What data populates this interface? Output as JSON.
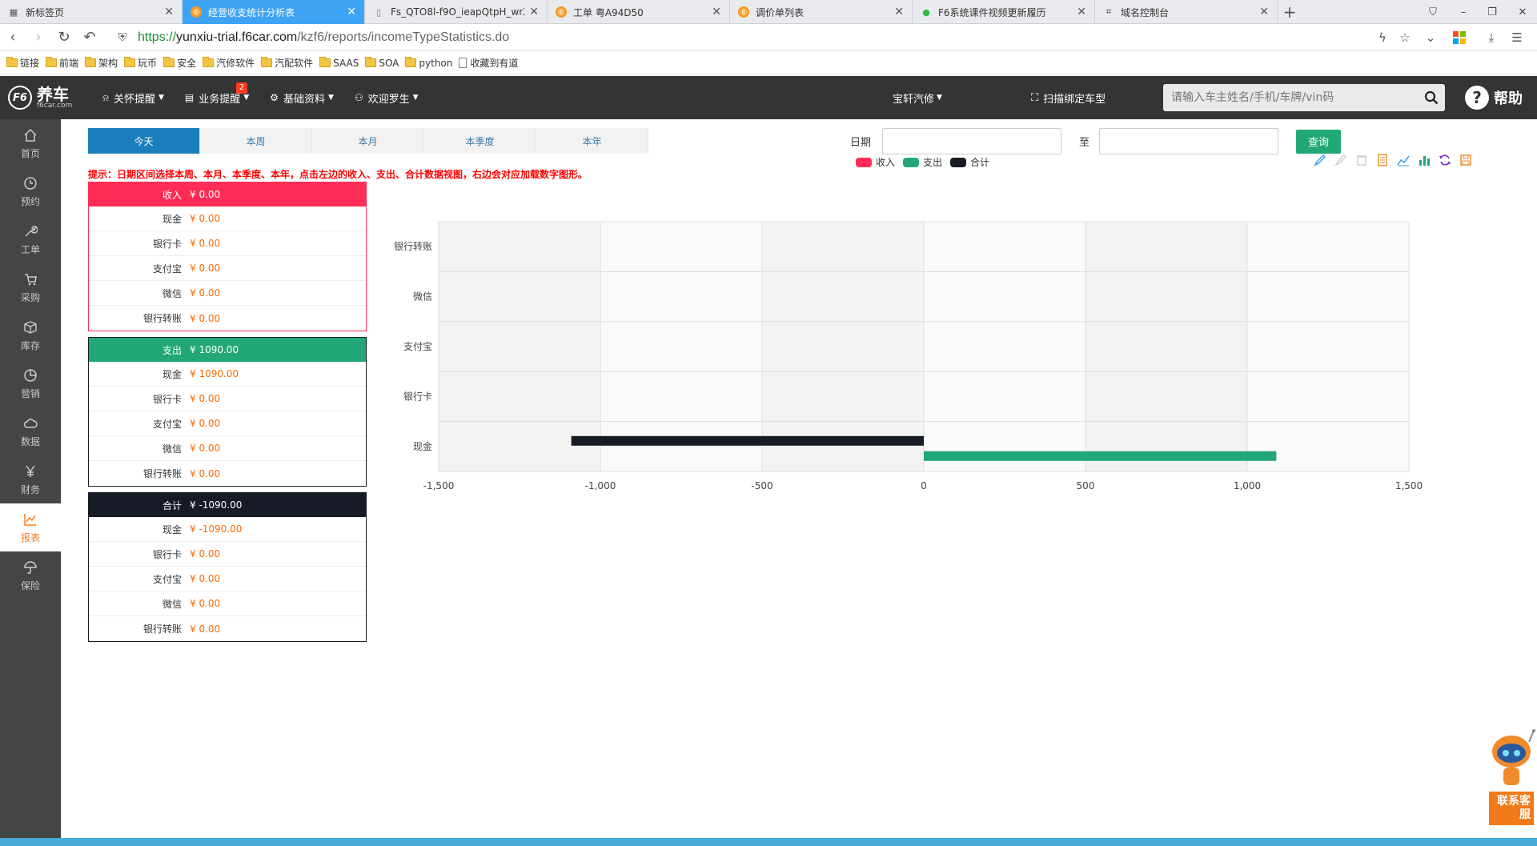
{
  "browser": {
    "tabs": [
      {
        "label": "新标签页",
        "icon": "grid-icon",
        "active": false
      },
      {
        "label": "经营收支统计分析表",
        "icon": "f6-logo-icon",
        "active": true
      },
      {
        "label": "Fs_QTO8l-f9O_ieapQtpH_wrZ",
        "icon": "page-icon",
        "active": false
      },
      {
        "label": "工单 粤A94D50",
        "icon": "f6-logo-icon",
        "active": false
      },
      {
        "label": "调价单列表",
        "icon": "f6-logo-icon",
        "active": false
      },
      {
        "label": "F6系统课件视频更新履历",
        "icon": "wechat-icon",
        "active": false
      },
      {
        "label": "域名控制台",
        "icon": "bracket-icon",
        "active": false
      }
    ],
    "url_proto": "https://",
    "url_host": "yunxiu-trial.f6car.com",
    "url_path": "/kzf6/reports/incomeTypeStatistics.do",
    "bookmarks": [
      "链接",
      "前端",
      "架构",
      "玩币",
      "安全",
      "汽修软件",
      "汽配软件",
      "SAAS",
      "SOA",
      "python",
      "收藏到有道"
    ]
  },
  "header": {
    "logo_text": "养车",
    "logo_sub": "f6car.com",
    "logo_badge": "F6",
    "menus": [
      {
        "label": "关怀提醒",
        "icon": "bell-icon"
      },
      {
        "label": "业务提醒",
        "icon": "clipboard-icon",
        "badge": "2"
      },
      {
        "label": "基础资料",
        "icon": "gear-icon"
      },
      {
        "label": "欢迎罗生",
        "icon": "user-icon"
      }
    ],
    "store": "宝轩汽修",
    "scan": "扫描绑定车型",
    "search_placeholder": "请输入车主姓名/手机/车牌/vin码",
    "help": "帮助"
  },
  "sidebar": [
    {
      "label": "首页",
      "icon": "home-icon"
    },
    {
      "label": "预约",
      "icon": "clock-icon"
    },
    {
      "label": "工单",
      "icon": "wrench-icon"
    },
    {
      "label": "采购",
      "icon": "cart-icon"
    },
    {
      "label": "库存",
      "icon": "box-icon"
    },
    {
      "label": "营销",
      "icon": "pie-icon"
    },
    {
      "label": "数据",
      "icon": "cloud-icon"
    },
    {
      "label": "财务",
      "icon": "yen-icon"
    },
    {
      "label": "报表",
      "icon": "chart-line-icon",
      "active": true
    },
    {
      "label": "保险",
      "icon": "umbrella-icon"
    }
  ],
  "periods": [
    "今天",
    "本周",
    "本月",
    "本季度",
    "本年"
  ],
  "date_filter": {
    "label": "日期",
    "to": "至",
    "query": "查询"
  },
  "hint": "提示：日期区间选择本周、本月、本季度、本年，点击左边的收入、支出、合计数据视图，右边会对应加载数字图形。",
  "panels": [
    {
      "title": "收入",
      "total": "¥ 0.00",
      "color": "#ff2d55",
      "rows": [
        {
          "label": "现金",
          "value": "¥ 0.00"
        },
        {
          "label": "银行卡",
          "value": "¥ 0.00"
        },
        {
          "label": "支付宝",
          "value": "¥ 0.00"
        },
        {
          "label": "微信",
          "value": "¥ 0.00"
        },
        {
          "label": "银行转账",
          "value": "¥ 0.00"
        }
      ]
    },
    {
      "title": "支出",
      "total": "¥ 1090.00",
      "color": "#22a877",
      "rows": [
        {
          "label": "现金",
          "value": "¥ 1090.00"
        },
        {
          "label": "银行卡",
          "value": "¥ 0.00"
        },
        {
          "label": "支付宝",
          "value": "¥ 0.00"
        },
        {
          "label": "微信",
          "value": "¥ 0.00"
        },
        {
          "label": "银行转账",
          "value": "¥ 0.00"
        }
      ]
    },
    {
      "title": "合计",
      "total": "¥ -1090.00",
      "color": "#161b26",
      "rows": [
        {
          "label": "现金",
          "value": "¥ -1090.00"
        },
        {
          "label": "银行卡",
          "value": "¥ 0.00"
        },
        {
          "label": "支付宝",
          "value": "¥ 0.00"
        },
        {
          "label": "微信",
          "value": "¥ 0.00"
        },
        {
          "label": "银行转账",
          "value": "¥ 0.00"
        }
      ]
    }
  ],
  "chart_data": {
    "type": "bar",
    "orientation": "horizontal",
    "categories": [
      "现金",
      "银行卡",
      "支付宝",
      "微信",
      "银行转账"
    ],
    "series": [
      {
        "name": "收入",
        "color": "#ff2d55",
        "values": [
          0,
          0,
          0,
          0,
          0
        ]
      },
      {
        "name": "支出",
        "color": "#22a877",
        "values": [
          1090,
          0,
          0,
          0,
          0
        ]
      },
      {
        "name": "合计",
        "color": "#161b26",
        "values": [
          -1090,
          0,
          0,
          0,
          0
        ]
      }
    ],
    "xlim": [
      -1500,
      1500
    ],
    "xticks": [
      -1500,
      -1000,
      -500,
      0,
      500,
      1000,
      1500
    ],
    "xtick_labels": [
      "-1,500",
      "-1,000",
      "-500",
      "0",
      "500",
      "1,000",
      "1,500"
    ],
    "grid": true,
    "legend_position": "top-center"
  },
  "robot_label": "联系客服"
}
